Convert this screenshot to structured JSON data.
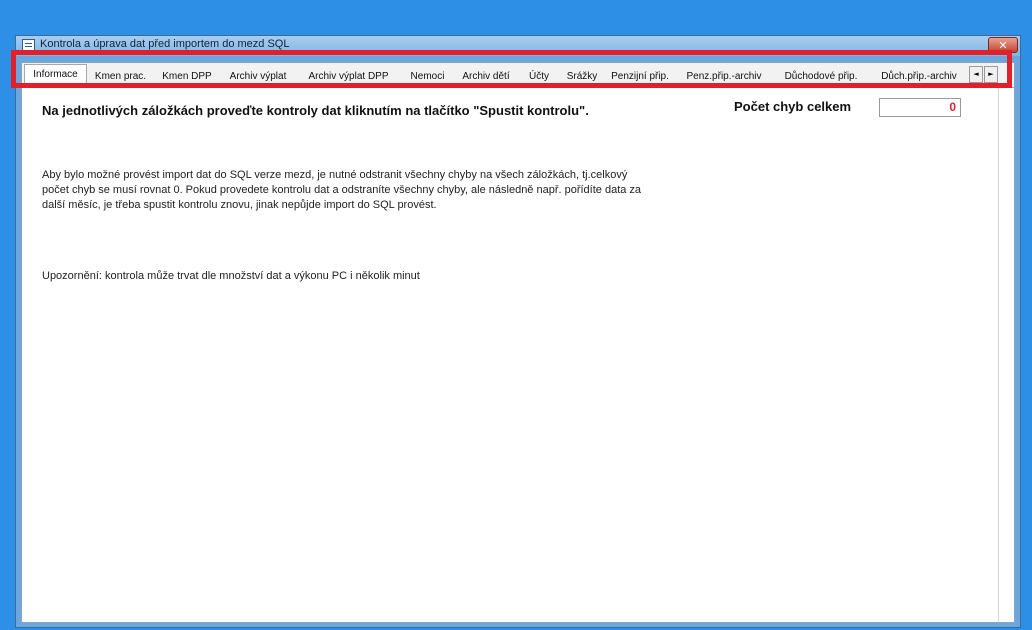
{
  "window": {
    "title": "Kontrola a úprava dat před importem do mezd SQL",
    "close_label": "✕"
  },
  "tabs": [
    {
      "label": "Informace",
      "active": true
    },
    {
      "label": "Kmen prac."
    },
    {
      "label": "Kmen DPP"
    },
    {
      "label": "Archiv výplat"
    },
    {
      "label": "Archiv výplat DPP"
    },
    {
      "label": "Nemoci"
    },
    {
      "label": "Archiv dětí"
    },
    {
      "label": "Účty"
    },
    {
      "label": "Srážky"
    },
    {
      "label": "Penzijní přip."
    },
    {
      "label": "Penz.přip.-archiv"
    },
    {
      "label": "Důchodové přip."
    },
    {
      "label": "Důch.přip.-archiv"
    }
  ],
  "tab_scroll": {
    "left": "◄",
    "right": "►"
  },
  "content": {
    "heading": "Na jednotlivých záložkách proveďte kontroly dat kliknutím na tlačítko \"Spustit kontrolu\".",
    "error_count_label": "Počet chyb celkem",
    "error_count_value": "0",
    "paragraph1": "Aby bylo možné provést import dat do SQL verze mezd, je nutné odstranit všechny chyby na všech záložkách, tj.celkový počet chyb se musí rovnat 0. Pokud provedete kontrolu dat a odstraníte všechny chyby, ale následně např. pořídíte data za další měsíc, je třeba spustit kontrolu znovu, jinak nepůjde import do SQL provést.",
    "paragraph2": "Upozornění: kontrola může trvat dle množství dat a výkonu PC i několik minut"
  },
  "colors": {
    "desktop": "#2e8fe6",
    "highlight": "#e0212b",
    "error_value": "#e0212b"
  }
}
